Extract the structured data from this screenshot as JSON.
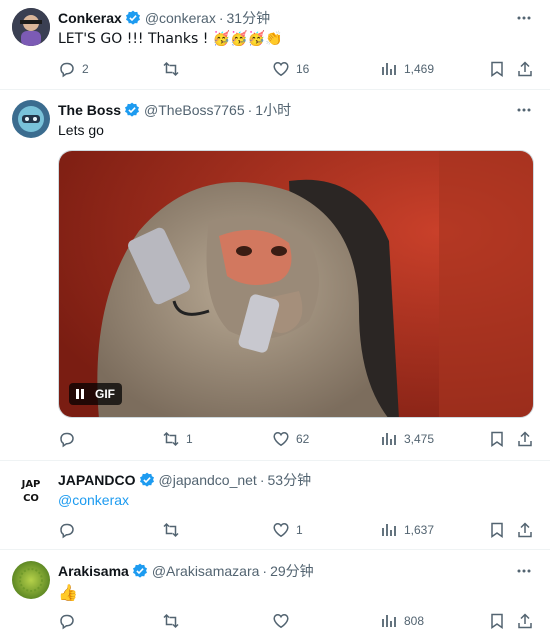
{
  "tweets": [
    {
      "name": "Conkerax",
      "handle": "@conkerax",
      "time": "31分钟",
      "text": "LET'S GO !!! Thanks ! 🥳🥳🥳👏",
      "actions": {
        "replies": "2",
        "reposts": "",
        "likes": "16",
        "views": "1,469"
      }
    },
    {
      "name": "The Boss",
      "handle": "@TheBoss7765",
      "time": "1小时",
      "text": "Lets go",
      "media": {
        "badge": "GIF"
      },
      "actions": {
        "replies": "",
        "reposts": "1",
        "likes": "62",
        "views": "3,475"
      }
    },
    {
      "name": "JAPANDCO",
      "handle": "@japandco_net",
      "time": "53分钟",
      "text": "@conkerax",
      "avatar_text": "JAP CO",
      "actions": {
        "replies": "",
        "reposts": "",
        "likes": "1",
        "views": "1,637"
      }
    },
    {
      "name": "Arakisama",
      "handle": "@Arakisamazara",
      "time": "29分钟",
      "text": "👍",
      "actions": {
        "replies": "",
        "reposts": "",
        "likes": "",
        "views": "808"
      }
    }
  ],
  "separator": "·",
  "icons": {
    "more": "more-horizontal-icon",
    "reply": "reply-icon",
    "repost": "repost-icon",
    "like": "heart-icon",
    "views": "views-chart-icon",
    "bookmark": "bookmark-icon",
    "share": "share-icon",
    "verified": "verified-badge-icon"
  },
  "colors": {
    "accent": "#1d9bf0",
    "muted": "#536471",
    "text": "#0f1419",
    "border": "#eff3f4"
  }
}
